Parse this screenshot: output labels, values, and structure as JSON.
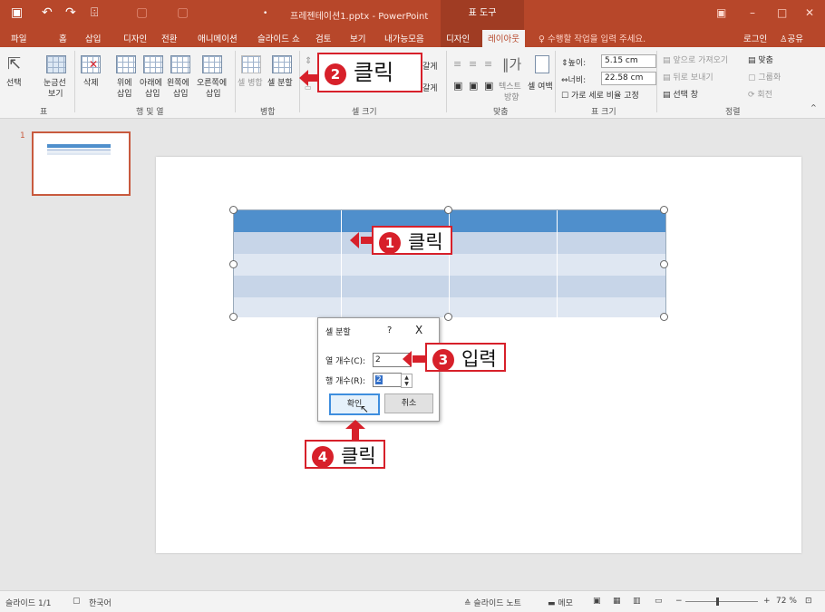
{
  "titlebar": {
    "qa_icons": [
      "save-icon",
      "undo-icon",
      "redo-icon",
      "presenter-icon",
      "touch-mode-icon",
      "start-icon"
    ],
    "title": "프레젠테이션1.pptx - PowerPoint",
    "context_group": "표 도구"
  },
  "tabs": [
    "파일",
    "홈",
    "삽입",
    "디자인",
    "전환",
    "애니메이션",
    "슬라이드 쇼",
    "검토",
    "보기",
    "내가능모음",
    "디자인",
    "레이아웃"
  ],
  "tell_me": "♀ 수행할 작업을 입력 주세요.",
  "account": {
    "login": "로그인",
    "share": "공유"
  },
  "ribbon": {
    "select": "선택",
    "gridlines": "눈금선",
    "gridlines2": "보기",
    "delete": "삭제",
    "insert_above": "위에",
    "insert_below": "아래에",
    "insert_left": "왼쪽에",
    "insert_right": "오른쪽에",
    "insert_sub": "삽입",
    "merge_cells": "셀 병합",
    "split_cells": "셀 분할",
    "dist_rows": "갈게",
    "dist_cols": "갈게",
    "text_direction": "텍스트",
    "text_direction2": "방향",
    "cell_margins": "셀 여백",
    "height_label": "높이:",
    "height_value": "5.15 cm",
    "width_label": "너비:",
    "width_value": "22.58 cm",
    "lock_aspect": "가로 세로 비율 고정",
    "bring_forward": "앞으로 가져오기",
    "send_backward": "뒤로 보내기",
    "selection_pane": "선택 창",
    "align": "맞춤",
    "group": "그룹화",
    "rotate": "회전",
    "groups": {
      "table": "표",
      "rows_cols": "행 및 열",
      "merge": "병합",
      "cell_size": "셀 크기",
      "alignment": "맞춤",
      "table_size": "표 크기",
      "arrange": "정렬"
    }
  },
  "slides_panel": {
    "number": "1"
  },
  "dialog": {
    "title": "셀 분할",
    "help": "?",
    "close": "X",
    "cols_label": "열 개수(C):",
    "cols_value": "2",
    "rows_label": "행 개수(R):",
    "rows_value": "2",
    "ok": "확인",
    "cancel": "취소"
  },
  "callouts": [
    {
      "num": "1",
      "text": "클릭"
    },
    {
      "num": "2",
      "text": "클릭"
    },
    {
      "num": "3",
      "text": "입력"
    },
    {
      "num": "4",
      "text": "클릭"
    }
  ],
  "statusbar": {
    "slide_info": "슬라이드 1/1",
    "language": "한국어",
    "notes": "슬라이드 노트",
    "comments": "메모",
    "zoom": "72 %"
  },
  "colors": {
    "accent": "#b7472a",
    "header_row": "#4f8fcc",
    "band_row": "#c7d5e8",
    "band_row_alt": "#dfe7f2",
    "callout": "#d7202a"
  }
}
